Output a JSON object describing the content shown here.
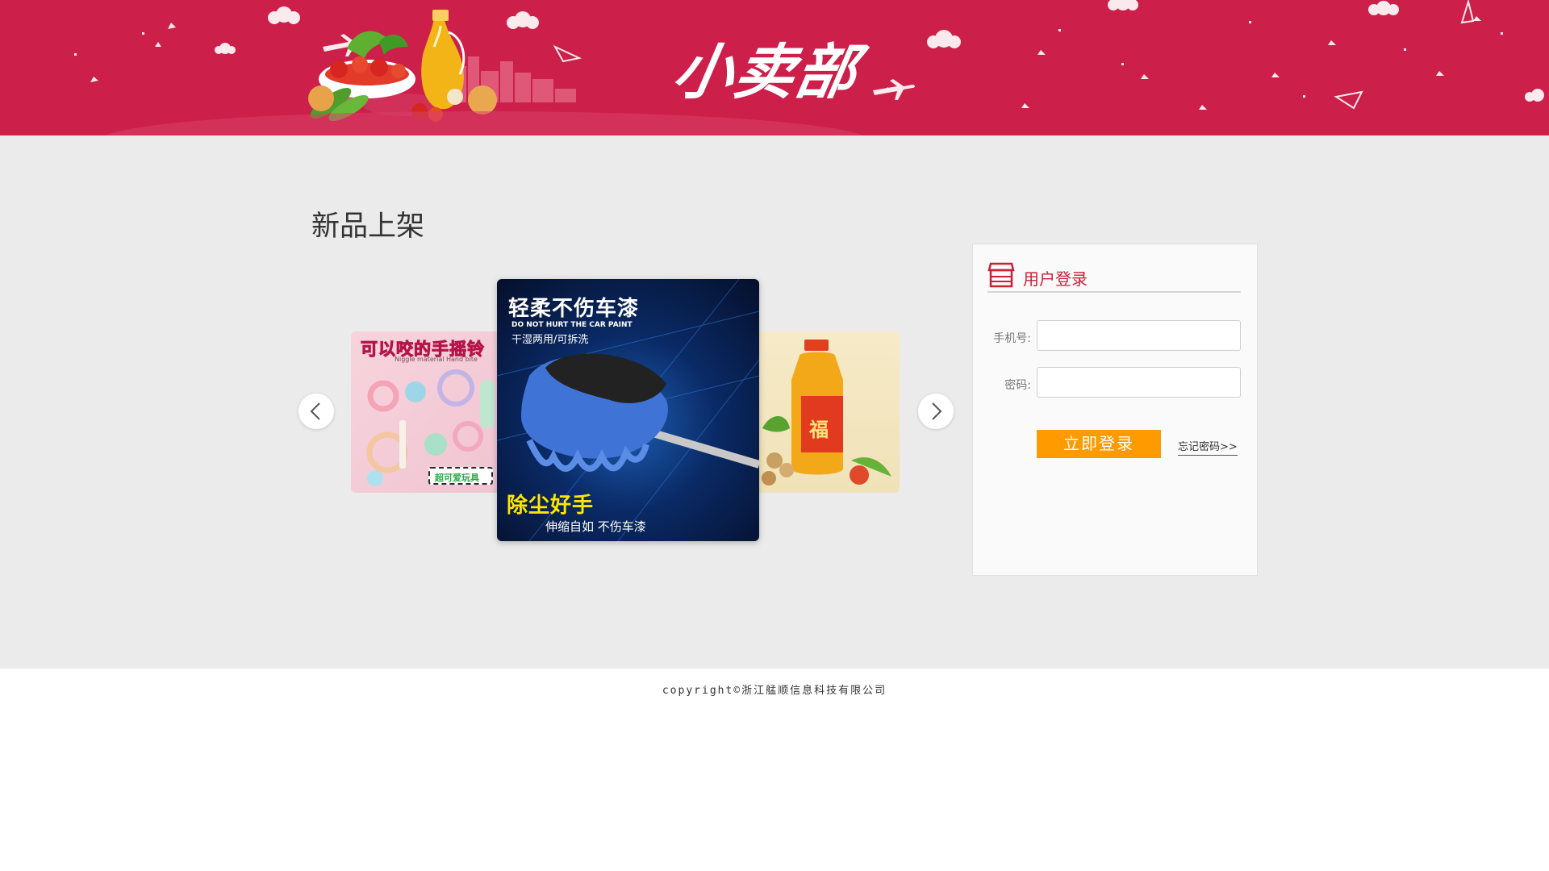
{
  "header": {
    "logo_text": "小卖部",
    "background_color": "#cc1f4a"
  },
  "main": {
    "section_title": "新品上架",
    "carousel": {
      "prev_icon": "chevron-left-icon",
      "next_icon": "chevron-right-icon",
      "slides": [
        {
          "caption": "可以咬的手摇铃",
          "subcaption": "Niggle material Hand bite",
          "sticker": "超可爱玩具"
        },
        {
          "headline": "轻柔不伤车漆",
          "english": "DO NOT HURT THE CAR PAINT",
          "tagline": "干湿两用/可拆洗",
          "bottom_headline": "除尘好手",
          "bottom_tagline": "伸缩自如 不伤车漆"
        },
        {
          "caption": "福"
        }
      ]
    }
  },
  "login": {
    "icon": "shop-icon",
    "title": "用户登录",
    "phone_label": "手机号:",
    "phone_value": "",
    "password_label": "密码:",
    "password_value": "",
    "submit_label": "立即登录",
    "forgot_label": "忘记密码>>",
    "accent_color": "#cc1f3a",
    "button_color": "#ff9a00"
  },
  "footer": {
    "copyright": "copyright©浙江艋顺信息科技有限公司"
  }
}
